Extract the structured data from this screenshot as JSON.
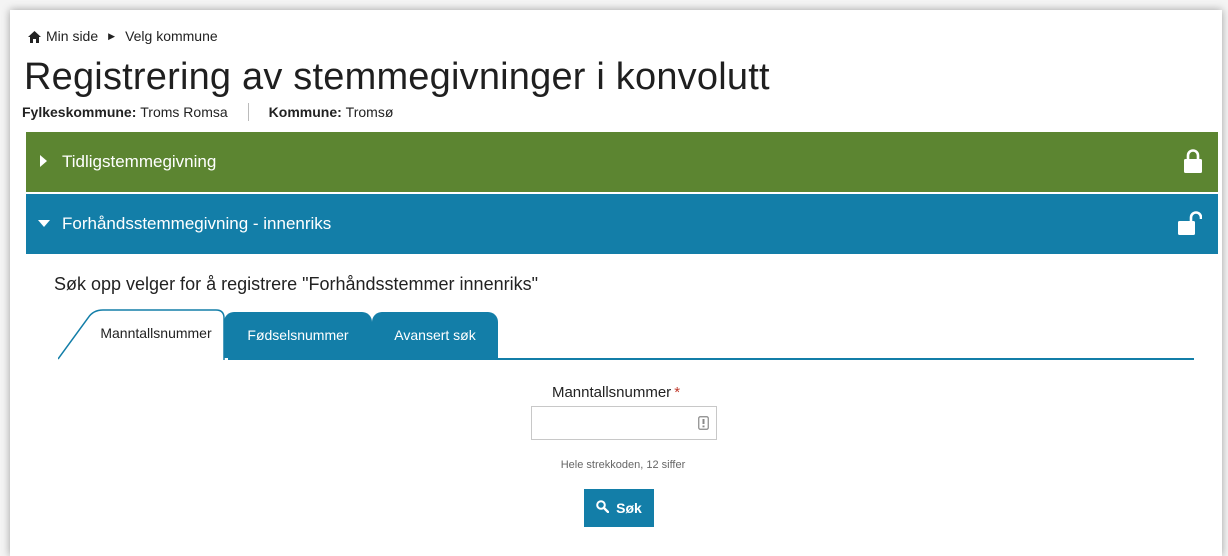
{
  "breadcrumb": {
    "home_label": "Min side",
    "current_label": "Velg kommune"
  },
  "page": {
    "title": "Registrering av stemmegivninger i konvolutt",
    "county_label": "Fylkeskommune:",
    "county_value": "Troms Romsa",
    "municipality_label": "Kommune:",
    "municipality_value": "Tromsø"
  },
  "panels": [
    {
      "label": "Tidligstemmegivning",
      "state": "collapsed",
      "lock": "locked",
      "color": "#5c8531"
    },
    {
      "label": "Forhåndsstemmegivning - innenriks",
      "state": "expanded",
      "lock": "unlocked",
      "color": "#137ea8"
    }
  ],
  "search": {
    "title": "Søk opp velger for å registrere \"Forhåndsstemmer innenriks\"",
    "tabs": [
      {
        "label": "Manntallsnummer",
        "active": true
      },
      {
        "label": "Fødselsnummer",
        "active": false
      },
      {
        "label": "Avansert søk",
        "active": false
      }
    ],
    "field_label": "Manntallsnummer",
    "required_mark": "*",
    "input_value": "",
    "hint": "Hele strekkoden, 12 siffer",
    "button_label": "Søk"
  },
  "colors": {
    "accent": "#137ea8",
    "green": "#5c8531",
    "required": "#c0392b"
  },
  "icons": [
    "home-icon",
    "chevron-right-icon",
    "caret-right-icon",
    "caret-down-icon",
    "lock-closed-icon",
    "lock-open-icon",
    "barcode-icon",
    "search-icon"
  ]
}
